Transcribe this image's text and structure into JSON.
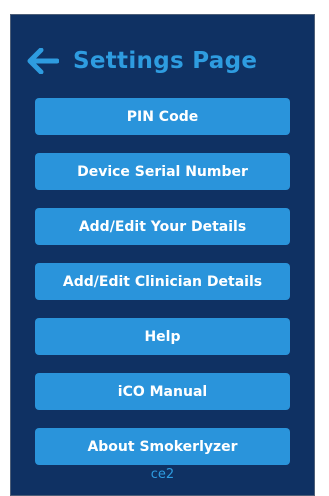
{
  "header": {
    "title": "Settings Page",
    "back_icon": "arrow-left-icon"
  },
  "menu": {
    "items": [
      {
        "label": "PIN Code"
      },
      {
        "label": "Device Serial Number"
      },
      {
        "label": "Add/Edit Your Details"
      },
      {
        "label": "Add/Edit Clinician Details"
      },
      {
        "label": "Help"
      },
      {
        "label": "iCO Manual"
      },
      {
        "label": "About Smokerlyzer"
      }
    ]
  },
  "footer": {
    "version": "ce2"
  },
  "colors": {
    "panel_background": "#0f3163",
    "accent": "#2e9ce0",
    "button_background": "#2a94db",
    "button_text": "#ffffff"
  }
}
